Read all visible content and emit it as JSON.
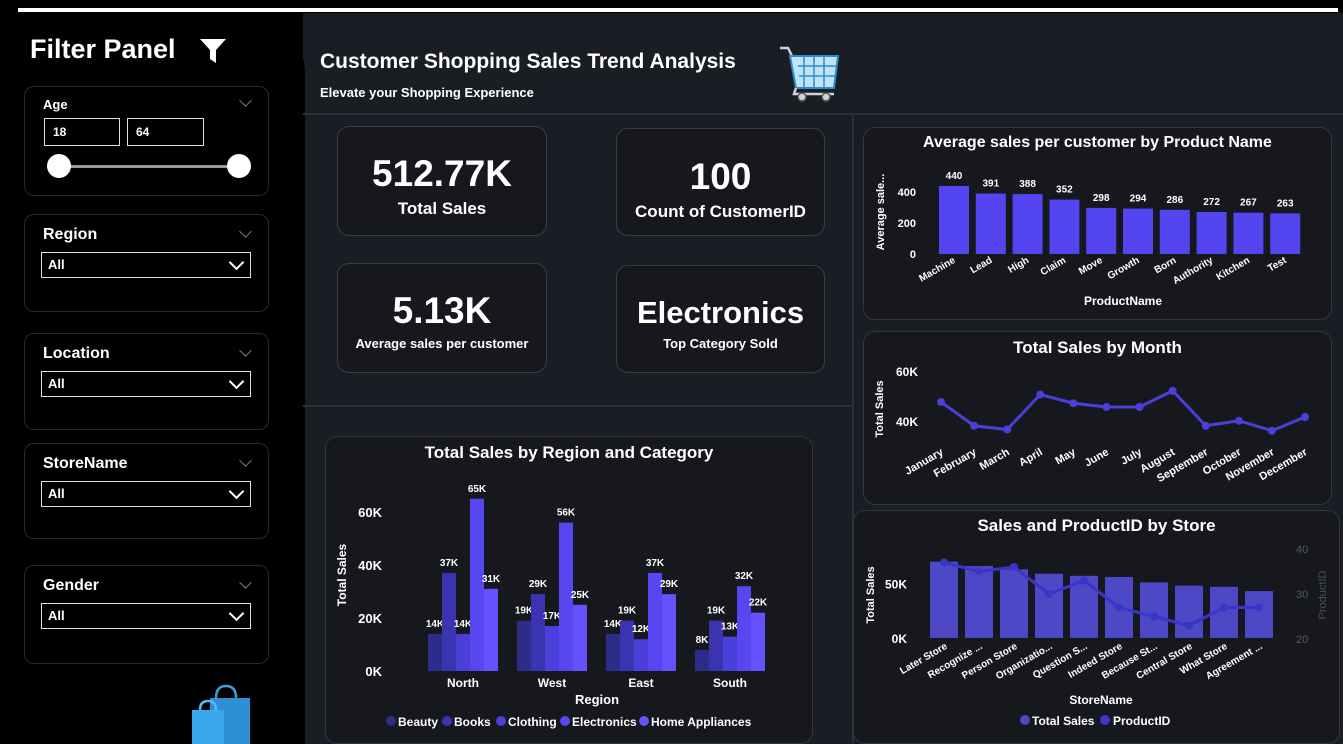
{
  "filter_panel": {
    "title": "Filter Panel",
    "age": {
      "label": "Age",
      "min": "18",
      "max": "64"
    },
    "region": {
      "label": "Region",
      "value": "All"
    },
    "location": {
      "label": "Location",
      "value": "All"
    },
    "store_name": {
      "label": "StoreName",
      "value": "All"
    },
    "gender": {
      "label": "Gender",
      "value": "All"
    }
  },
  "header": {
    "title": "Customer Shopping Sales Trend Analysis",
    "subtitle": "Elevate your Shopping Experience"
  },
  "kpis": {
    "total_sales": {
      "value": "512.77K",
      "label": "Total Sales"
    },
    "customer_count": {
      "value": "100",
      "label": "Count of CustomerID"
    },
    "avg_sales": {
      "value": "5.13K",
      "label": "Average sales per customer"
    },
    "top_category": {
      "value": "Electronics",
      "label": "Top Category Sold"
    }
  },
  "colors": {
    "bar": "#5346f0",
    "line": "#4a3fd9",
    "store_bar": "#4d48c6",
    "product_line": "#3b34c9",
    "region_series": [
      "#2d2c88",
      "#3a34b0",
      "#4a3fd8",
      "#5747f0",
      "#6552ff"
    ]
  },
  "chart_data": [
    {
      "type": "bar",
      "title": "Average sales per customer by Product Name",
      "xlabel": "ProductName",
      "ylabel": "Average sale...",
      "categories": [
        "Machine",
        "Lead",
        "High",
        "Claim",
        "Move",
        "Growth",
        "Born",
        "Authority",
        "Kitchen",
        "Test"
      ],
      "values": [
        440,
        391,
        388,
        352,
        298,
        294,
        286,
        272,
        267,
        263
      ],
      "yticks": [
        "0",
        "200",
        "400"
      ],
      "ylim": [
        0,
        460
      ]
    },
    {
      "type": "line",
      "title": "Total Sales by Month",
      "ylabel": "Total Sales",
      "categories": [
        "January",
        "February",
        "March",
        "April",
        "May",
        "June",
        "July",
        "August",
        "September",
        "October",
        "November",
        "December"
      ],
      "values": [
        48000,
        38500,
        37000,
        51000,
        47500,
        46000,
        46000,
        52500,
        38500,
        40500,
        36500,
        42000
      ],
      "yticks": [
        "40K",
        "60K"
      ],
      "ylim": [
        30000,
        62000
      ]
    },
    {
      "type": "bar",
      "title": "Total Sales by Region and Category",
      "xlabel": "Region",
      "ylabel": "Total Sales",
      "categories": [
        "North",
        "West",
        "East",
        "South"
      ],
      "series": [
        {
          "name": "Beauty",
          "values": [
            14000,
            19000,
            14000,
            8000
          ],
          "labels": [
            "14K",
            "19K",
            "14K",
            "8K"
          ]
        },
        {
          "name": "Books",
          "values": [
            37000,
            29000,
            19000,
            19000
          ],
          "labels": [
            "37K",
            "29K",
            "19K",
            "19K"
          ]
        },
        {
          "name": "Clothing",
          "values": [
            14000,
            17000,
            12000,
            13000
          ],
          "labels": [
            "14K",
            "17K",
            "12K",
            "13K"
          ]
        },
        {
          "name": "Electronics",
          "values": [
            65000,
            56000,
            37000,
            32000
          ],
          "labels": [
            "65K",
            "56K",
            "37K",
            "32K"
          ]
        },
        {
          "name": "Home Appliances",
          "values": [
            31000,
            25000,
            29000,
            22000
          ],
          "labels": [
            "31K",
            "25K",
            "29K",
            "22K"
          ]
        }
      ],
      "yticks": [
        "0K",
        "20K",
        "40K",
        "60K"
      ],
      "ylim": [
        0,
        68000
      ],
      "legend": "bottom"
    },
    {
      "type": "bar",
      "title": "Sales and ProductID by Store",
      "xlabel": "StoreName",
      "ylabel": "Total Sales",
      "y2label": "ProductID",
      "categories": [
        "Later Store",
        "Recognize ...",
        "Person Store",
        "Organizatio...",
        "Question S...",
        "Indeed Store",
        "Because St...",
        "Central Store",
        "What Store",
        "Agreement ..."
      ],
      "series": [
        {
          "name": "Total Sales",
          "type": "bar",
          "values": [
            70000,
            66000,
            63000,
            59000,
            57000,
            56000,
            51000,
            48000,
            47000,
            43000
          ]
        },
        {
          "name": "ProductID",
          "type": "line",
          "values": [
            37,
            35,
            36,
            30,
            33,
            27,
            25,
            23,
            27,
            27
          ]
        }
      ],
      "yticks": [
        "0K",
        "50K"
      ],
      "y2ticks": [
        "20",
        "30",
        "40"
      ],
      "ylim": [
        0,
        95000
      ],
      "y2lim": [
        17,
        41
      ],
      "legend": "bottom"
    }
  ]
}
